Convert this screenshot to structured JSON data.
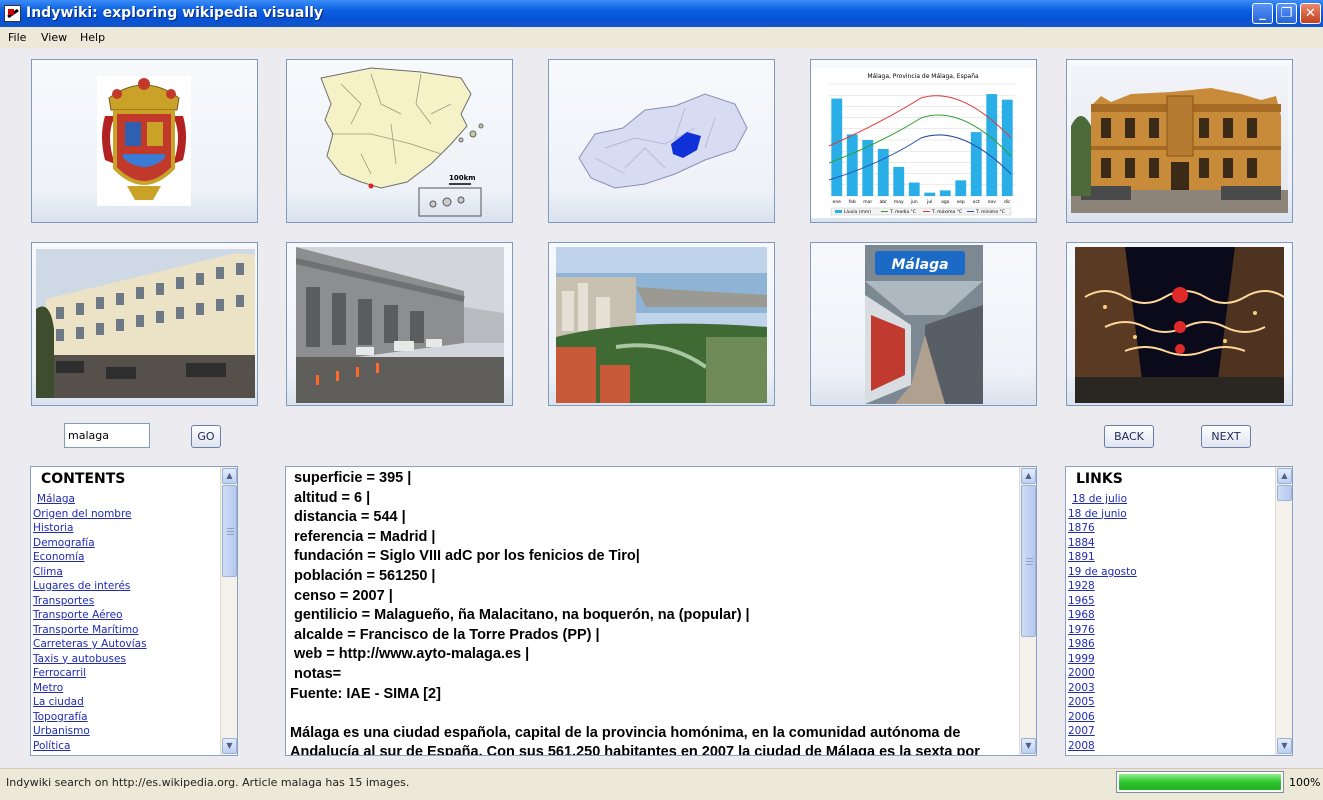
{
  "window": {
    "title": "Indywiki: exploring wikipedia visually"
  },
  "menu": [
    "File",
    "View",
    "Help"
  ],
  "images": [
    {
      "subject": "Málaga coat of arms"
    },
    {
      "subject": "Map of Spain with Málaga province"
    },
    {
      "subject": "Map of Málaga province with municipality highlighted"
    },
    {
      "subject": "Climate chart of Málaga"
    },
    {
      "subject": "Episcopal palace facade"
    },
    {
      "subject": "Plaza de la Merced buildings"
    },
    {
      "subject": "Airport terminal entrance"
    },
    {
      "subject": "Aerial view of city and port"
    },
    {
      "subject": "Málaga train station platform"
    },
    {
      "subject": "Street with Christmas lights"
    }
  ],
  "climate_chart": {
    "title": "Málaga, Provincia de Málaga, España",
    "months": [
      "ene",
      "feb",
      "mar",
      "abr",
      "may",
      "jun",
      "jul",
      "ago",
      "sep",
      "oct",
      "nov",
      "dic"
    ],
    "precipitation": [
      87,
      55,
      50,
      42,
      26,
      12,
      3,
      5,
      14,
      57,
      91,
      86
    ],
    "legend": [
      "Lluvia (mm)",
      "T. media °C",
      "T. máxima °C",
      "T. mínima °C"
    ],
    "colors": {
      "bars": "#29aee7",
      "mean": "#2e9e2e",
      "max": "#e03a3a",
      "min": "#2b4fa8"
    }
  },
  "station_sign": "Málaga",
  "search": {
    "value": "malaga",
    "go_label": "GO"
  },
  "nav": {
    "back_label": "BACK",
    "next_label": "NEXT"
  },
  "contents": {
    "title": "CONTENTS",
    "items": [
      "Málaga",
      "Origen del nombre",
      "Historia",
      "Demografía",
      "Economía",
      "Clima",
      "Lugares de interés",
      "Transportes",
      "Transporte Aéreo",
      "Transporte Marítimo",
      "Carreteras y Autovías",
      "Taxis y autobuses",
      "Ferrocarril",
      "Metro",
      "La ciudad",
      "Topografía",
      "Urbanismo",
      "Política"
    ]
  },
  "article": {
    "lines": [
      "superficie = 395 |",
      "altitud = 6 |",
      "distancia = 544 |",
      "referencia = Madrid |",
      "fundación = Siglo VIII adC por los fenicios de Tiro|",
      "población = 561250  |",
      "censo = 2007 |",
      "gentilicio = Malagueño, ña Malacitano, na  boquerón, na (popular) |",
      "alcalde = Francisco de la Torre Prados (PP) |",
      "web = http://www.ayto-malaga.es |",
      "notas=",
      "Fuente: IAE - SIMA [2]",
      "",
      "Málaga es una ciudad española, capital de la provincia homónima, en la comunidad autónoma de",
      "Andalucía al sur de España. Con sus 561.250 habitantes en 2007 la ciudad de Málaga es la sexta por"
    ]
  },
  "links": {
    "title": "LINKS",
    "items": [
      "18 de julio",
      "18 de junio",
      "1876",
      "1884",
      "1891",
      "19 de agosto",
      "1928",
      "1965",
      "1968",
      "1976",
      "1986",
      "1999",
      "2000",
      "2003",
      "2005",
      "2006",
      "2007",
      "2008"
    ]
  },
  "status": {
    "text": "Indywiki search on http://es.wikipedia.org. Article malaga has 15 images.",
    "progress_percent": 100,
    "progress_label": "100%"
  }
}
